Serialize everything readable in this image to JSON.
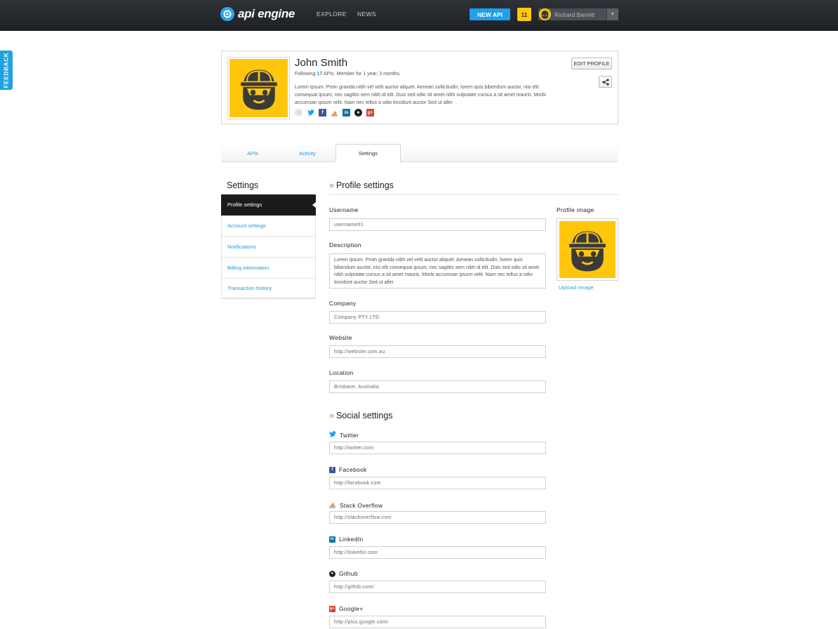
{
  "header": {
    "brand": "api engine",
    "nav": [
      "EXPLORE",
      "NEWS"
    ],
    "new_api_label": "NEW API",
    "notification_count": "11",
    "user_name": "Richard Barrett"
  },
  "feedback_label": "FEEDBACK",
  "profile": {
    "name": "John Smith",
    "following_prefix": "Following",
    "following_count": "17",
    "following_suffix": "APIs. Member for 1 year, 3 months.",
    "bio": "Lorem Ipsum. Proin gravida nibh vel velit auctor aliquet. Aenean sollicitudin, lorem quis bibendum auctor, nisi elit consequat ipsum, nec sagittis sem nibh id elit. Duis sed odio sit amet nibh vulputate cursus a sit amet mauris. Morbi accumsan ipsum velit. Nam nec tellus a odio tincidunt auctor Sed ut aller",
    "edit_label": "EDIT PROFILE",
    "social_icons": [
      "website-icon",
      "twitter-icon",
      "facebook-icon",
      "stackoverflow-icon",
      "linkedin-icon",
      "github-icon",
      "googleplus-icon"
    ]
  },
  "tabs": [
    "APIs",
    "Activity",
    "Settings"
  ],
  "sidebar": {
    "title": "Settings",
    "items": [
      "Profile settings",
      "Account settings",
      "Notifications",
      "Billing information",
      "Transaction history"
    ]
  },
  "profile_settings": {
    "title": "Profile settings",
    "username_label": "Username",
    "username_value": "username01",
    "description_label": "Description",
    "description_value": "Lorem Ipsum. Proin gravida nibh vel velit auctor aliquet. Aenean sollicitudin, lorem quis bibendum auctor, nisi elit consequat ipsum, nec sagittis sem nibh id elit. Duis sed odio sit amet nibh vulputate cursus a sit amet mauris. Morbi accumsan ipsum velit. Nam nec tellus a odio tincidunt auctor Sed ut aller",
    "company_label": "Company",
    "company_value": "Company PTY LTD",
    "website_label": "Website",
    "website_value": "http://website.com.au",
    "location_label": "Location",
    "location_value": "Brisbane, Australia",
    "image_label": "Profile image",
    "upload_label": "Upload image"
  },
  "social_settings": {
    "title": "Social settings",
    "fields": [
      {
        "label": "Twitter",
        "value": "http://twitter.com",
        "icon": "twitter-icon"
      },
      {
        "label": "Facebook",
        "value": "http://facebook.com",
        "icon": "facebook-icon"
      },
      {
        "label": "Stack Overflow",
        "value": "http://stackoverflow.com",
        "icon": "stackoverflow-icon"
      },
      {
        "label": "LinkedIn",
        "value": "http://linkedin.com",
        "icon": "linkedin-icon"
      },
      {
        "label": "Github",
        "value": "http://githib.com/",
        "icon": "github-icon"
      },
      {
        "label": "Google+",
        "value": "http://plus.google.com/",
        "icon": "googleplus-icon"
      }
    ]
  },
  "colors": {
    "accent": "#1e9ae0",
    "brand_yellow": "#ffc60b",
    "topbar": "#25292e",
    "active_nav": "#1b1b1b"
  }
}
